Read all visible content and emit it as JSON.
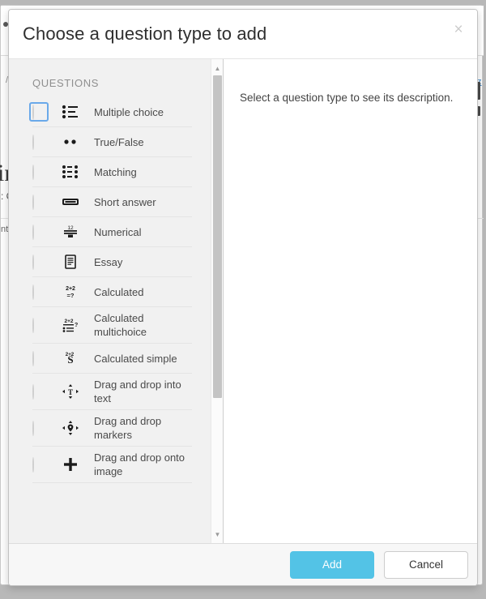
{
  "background_page": {
    "breadcrumb": "/",
    "title": "ing",
    "subtitle": ": C",
    "note": "nte",
    "link": "z",
    "chevron": "‹"
  },
  "modal": {
    "title": "Choose a question type to add",
    "close_label": "×",
    "group_label": "QUESTIONS",
    "description": "Select a question type to see its description.",
    "accent_color": "#53c3e6",
    "focus_color": "#6aa9e9",
    "questions": [
      {
        "label": "Multiple choice",
        "icon": "multiple-choice-icon",
        "selected": false,
        "focused": true
      },
      {
        "label": "True/False",
        "icon": "true-false-icon",
        "selected": false,
        "focused": false
      },
      {
        "label": "Matching",
        "icon": "matching-icon",
        "selected": false,
        "focused": false
      },
      {
        "label": "Short answer",
        "icon": "short-answer-icon",
        "selected": false,
        "focused": false
      },
      {
        "label": "Numerical",
        "icon": "numerical-icon",
        "selected": false,
        "focused": false
      },
      {
        "label": "Essay",
        "icon": "essay-icon",
        "selected": false,
        "focused": false
      },
      {
        "label": "Calculated",
        "icon": "calculated-icon",
        "selected": false,
        "focused": false
      },
      {
        "label": "Calculated multichoice",
        "icon": "calculated-multichoice-icon",
        "selected": false,
        "focused": false
      },
      {
        "label": "Calculated simple",
        "icon": "calculated-simple-icon",
        "selected": false,
        "focused": false
      },
      {
        "label": "Drag and drop into text",
        "icon": "drag-drop-text-icon",
        "selected": false,
        "focused": false
      },
      {
        "label": "Drag and drop markers",
        "icon": "drag-drop-markers-icon",
        "selected": false,
        "focused": false
      },
      {
        "label": "Drag and drop onto image",
        "icon": "drag-drop-image-icon",
        "selected": false,
        "focused": false
      }
    ],
    "footer": {
      "add_label": "Add",
      "cancel_label": "Cancel"
    },
    "scrollbar": {
      "up_arrow": "▲",
      "down_arrow": "▼"
    }
  }
}
